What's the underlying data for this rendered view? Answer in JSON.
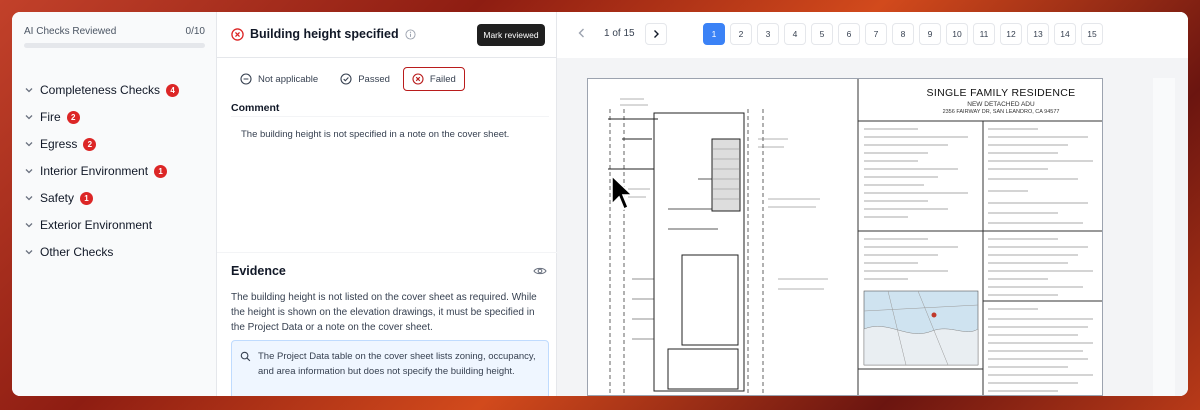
{
  "sidebar": {
    "ai_checks_label": "AI Checks Reviewed",
    "ai_checks_count": "0/10",
    "progress_fraction": 0,
    "categories": [
      {
        "label": "Completeness Checks",
        "badge": "4"
      },
      {
        "label": "Fire",
        "badge": "2"
      },
      {
        "label": "Egress",
        "badge": "2"
      },
      {
        "label": "Interior Environment",
        "badge": "1"
      },
      {
        "label": "Safety",
        "badge": "1"
      },
      {
        "label": "Exterior Environment",
        "badge": ""
      },
      {
        "label": "Other Checks",
        "badge": ""
      }
    ]
  },
  "check": {
    "title": "Building height specified",
    "mark_reviewed": "Mark reviewed",
    "status_options": [
      {
        "label": "Not applicable",
        "selected": false
      },
      {
        "label": "Passed",
        "selected": false
      },
      {
        "label": "Failed",
        "selected": true
      }
    ],
    "comment_label": "Comment",
    "comment_text": "The building height is not specified in a note on the cover sheet.",
    "evidence_label": "Evidence",
    "evidence_text": "The building height is not listed on the cover sheet as required. While the height is shown on the elevation drawings, it must be specified in the Project Data or a note on the cover sheet.",
    "evidence_quote": "The Project Data table on the cover sheet lists zoning, occupancy, and area information but does not specify the building height."
  },
  "viewer": {
    "page_indicator": "1 of 15",
    "pages": [
      "1",
      "2",
      "3",
      "4",
      "5",
      "6",
      "7",
      "8",
      "9",
      "10",
      "11",
      "12",
      "13",
      "14",
      "15"
    ],
    "active_page": "1",
    "sheet_title": "SINGLE FAMILY RESIDENCE",
    "sheet_subtitle": "NEW DETACHED ADU",
    "sheet_address": "2356 FAIRWAY DR, SAN LEANDRO, CA 94577"
  },
  "colors": {
    "accent": "#3b82f6",
    "danger": "#dc2626",
    "dark_button": "#1f1f1f"
  }
}
